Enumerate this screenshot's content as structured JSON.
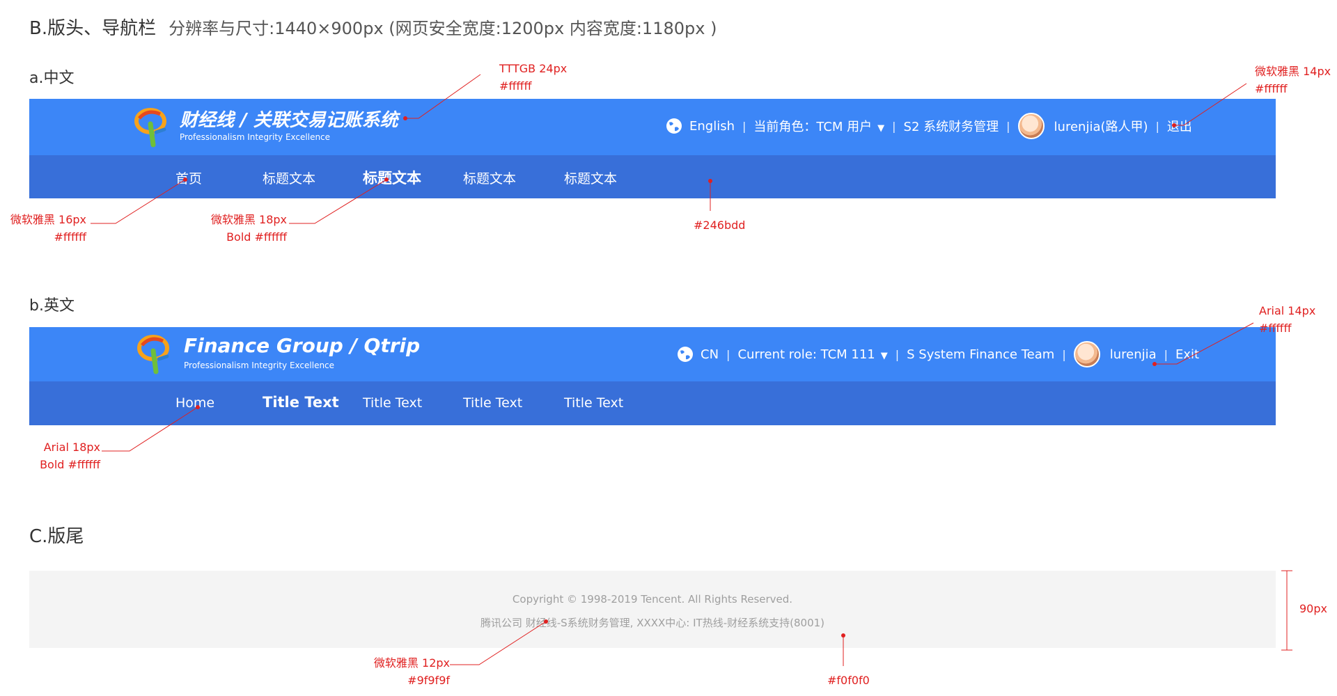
{
  "section_b": {
    "title": "B.版头、导航栏",
    "note": "分辨率与尺寸:1440×900px  (网页安全宽度:1200px 内容宽度:1180px )"
  },
  "variant_cn": {
    "label": "a.中文",
    "brand_title": "财经线  /  关联交易记账系统",
    "brand_sub": "Professionalism Integrity Excellence",
    "lang": "English",
    "role": "当前角色：TCM 用户",
    "system": "S2 系统财务管理",
    "user": "lurenjia(路人甲)",
    "logout": "退出",
    "nav": [
      "首页",
      "标题文本",
      "标题文本",
      "标题文本",
      "标题文本"
    ]
  },
  "variant_en": {
    "label": "b.英文",
    "brand_title": "Finance Group / Qtrip",
    "brand_sub": "Professionalism Integrity Excellence",
    "lang": "CN",
    "role": "Current role: TCM 111",
    "system": "S System Finance Team",
    "user": "lurenjia",
    "logout": "Exit",
    "nav": [
      "Home",
      "Title Text",
      "Title Text",
      "Title Text",
      "Title Text"
    ]
  },
  "section_c": {
    "title": "C.版尾",
    "footer_line1": "Copyright © 1998-2019 Tencent. All Rights Reserved.",
    "footer_line2": "腾讯公司 财经线-S系统财务管理, XXXX中心: IT热线-财经系统支持(8001)",
    "height_label": "90px"
  },
  "annotations": {
    "brand_font": "TTTGB 24px",
    "brand_color": "#ffffff",
    "util_font_cn": "微软雅黑 14px",
    "util_color_cn": "#ffffff",
    "nav_font_cn": "微软雅黑 16px",
    "nav_color_cn": "#ffffff",
    "nav_active_font_cn": "微软雅黑 18px",
    "nav_active_style_cn": "Bold  #ffffff",
    "nav_bg": "#246bdd",
    "util_font_en": "Arial 14px",
    "util_color_en": "#ffffff",
    "nav_font_en": "Arial 18px",
    "nav_style_en": "Bold  #ffffff",
    "footer_font": "微软雅黑 12px",
    "footer_color": "#9f9f9f",
    "footer_bg": "#f0f0f0"
  },
  "colors": {
    "topbar": "#3c86f7",
    "navbar": "#386fd9",
    "annotation": "#e02020"
  }
}
